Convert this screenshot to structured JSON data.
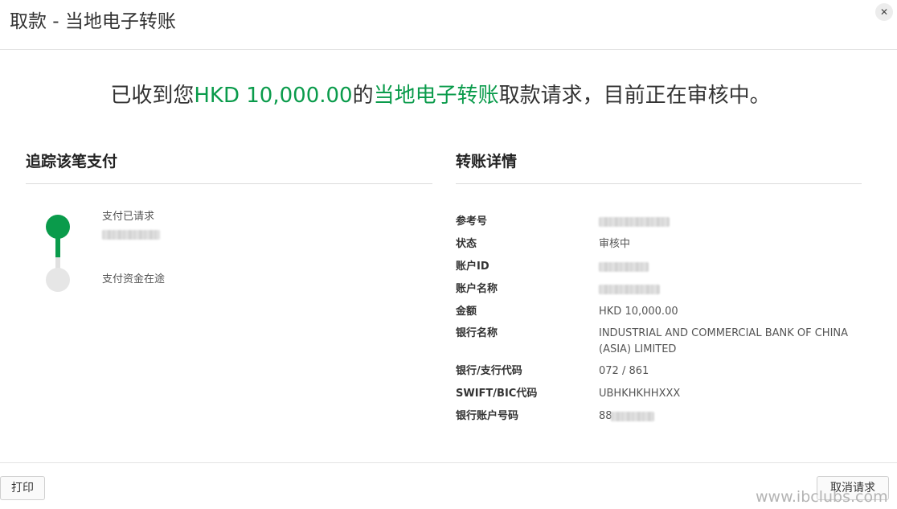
{
  "dialog": {
    "title": "取款 - 当地电子转账",
    "close_glyph": "✕"
  },
  "headline": {
    "prefix": "已收到您",
    "amount": "HKD 10,000.00",
    "middle": "的",
    "method": "当地电子转账",
    "suffix": "取款请求，目前正在审核中。"
  },
  "tracking": {
    "title": "追踪该笔支付",
    "steps": [
      {
        "label": "支付已请求",
        "status": "done"
      },
      {
        "label": "支付资金在途",
        "status": "pending"
      }
    ]
  },
  "details": {
    "title": "转账详情",
    "rows": [
      {
        "label": "参考号",
        "value": ""
      },
      {
        "label": "状态",
        "value": "审核中"
      },
      {
        "label": "账户ID",
        "value": ""
      },
      {
        "label": "账户名称",
        "value": ""
      },
      {
        "label": "金额",
        "value": "HKD 10,000.00"
      },
      {
        "label": "银行名称",
        "value": "INDUSTRIAL AND COMMERCIAL BANK OF CHINA (ASIA) LIMITED"
      },
      {
        "label": "银行/支行代码",
        "value": "072 / 861"
      },
      {
        "label": "SWIFT/BIC代码",
        "value": "UBHKHKHHXXX"
      },
      {
        "label": "银行账户号码",
        "value": "88"
      }
    ]
  },
  "footer": {
    "print_label": "打印",
    "cancel_label": "取消请求"
  },
  "watermark": "www.ibclubs.com",
  "colors": {
    "accent_green": "#0a9b4b",
    "pending_gray": "#e6e6e6"
  }
}
